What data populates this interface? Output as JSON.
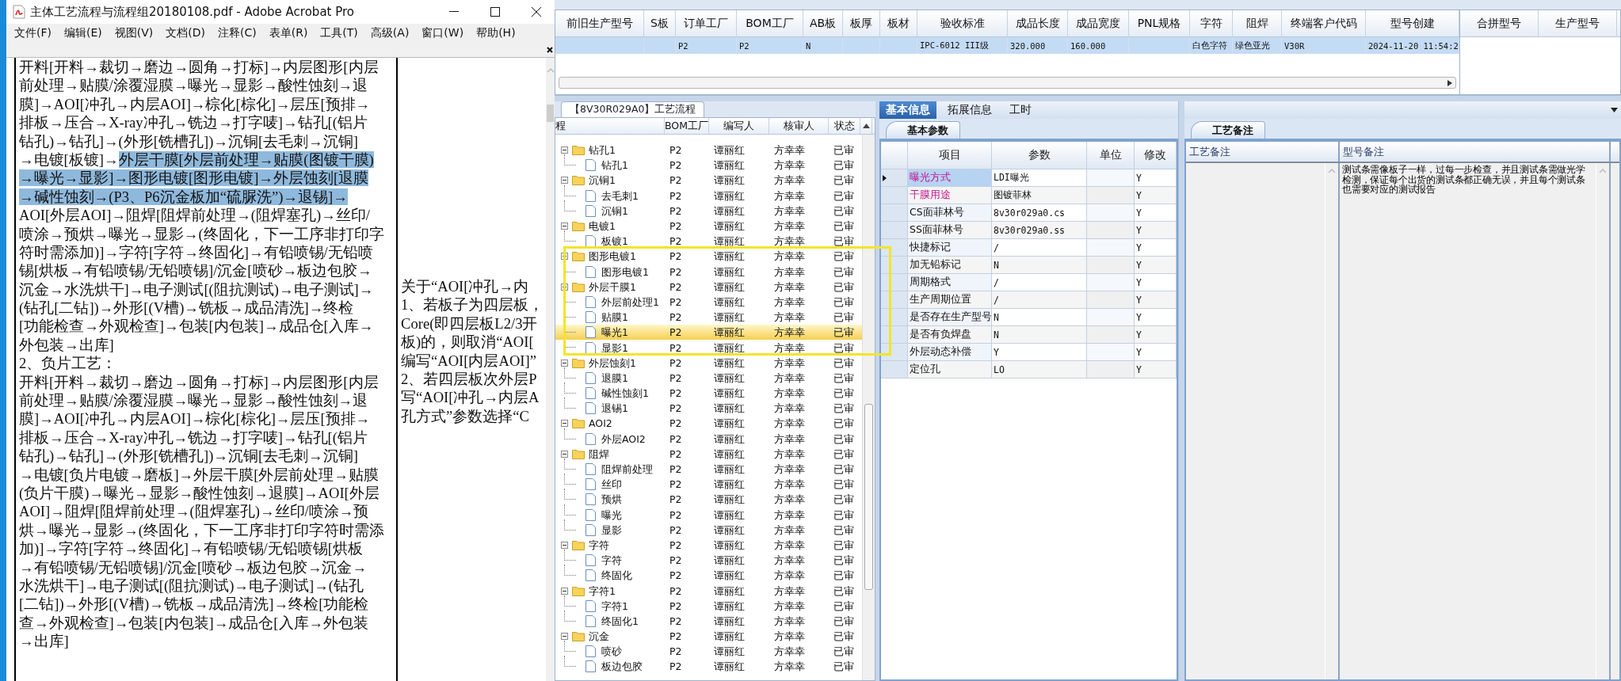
{
  "acrobat": {
    "title": "主体工艺流程与流程组20180108.pdf - Adobe Acrobat Pro",
    "menu": [
      "文件(F)",
      "编辑(E)",
      "视图(V)",
      "文档(D)",
      "注释(C)",
      "表单(R)",
      "工具(T)",
      "高级(A)",
      "窗口(W)",
      "帮助(H)"
    ],
    "main_lines": [
      [
        {
          "text": "开料[开料→裁切→磨边→圆角→打标]→内层图形[内层",
          "highlighted": false
        }
      ],
      [
        {
          "text": "前处理→贴膜/涂覆湿膜→曝光→显影→酸性蚀刻→退",
          "highlighted": false
        }
      ],
      [
        {
          "text": "膜]→AOI[冲孔→内层AOI]→棕化[棕化]→层压[预排→",
          "highlighted": false
        }
      ],
      [
        {
          "text": "排板→压合→X-ray冲孔→铣边→打字唛]→钻孔[(铝片",
          "highlighted": false
        }
      ],
      [
        {
          "text": "钻孔)→钻孔]→(外形[铣槽孔])→沉铜[去毛刺→沉铜]",
          "highlighted": false
        }
      ],
      [
        {
          "text": "→电镀[板镀]→",
          "highlighted": false
        },
        {
          "text": "外层干膜[外层前处理→贴膜(图镀干膜)",
          "highlighted": true
        }
      ],
      [
        {
          "text": "→曝光→显影]→图形电镀[图形电镀]→外层蚀刻[退膜",
          "highlighted": true
        }
      ],
      [
        {
          "text": "→碱性蚀刻→(P3、P6沉金板加“硫脲洗”)→退锡]→",
          "highlighted": true
        }
      ],
      [
        {
          "text": "AOI[外层AOI]→阻焊[阻焊前处理→(阻焊塞孔)→丝印/",
          "highlighted": false
        }
      ],
      [
        {
          "text": "喷涂→预烘→曝光→显影→(终固化，下一工序非打印字",
          "highlighted": false
        }
      ],
      [
        {
          "text": "符时需添加)]→字符[字符→终固化]→有铅喷锡/无铅喷",
          "highlighted": false
        }
      ],
      [
        {
          "text": "锡[烘板→有铅喷锡/无铅喷锡]/沉金[喷砂→板边包胶→",
          "highlighted": false
        }
      ],
      [
        {
          "text": "沉金→水洗烘干]→电子测试[(阻抗测试)→电子测试]→",
          "highlighted": false
        }
      ],
      [
        {
          "text": "(钻孔[二钻])→外形[(V槽)→铣板→成品清洗]→终检",
          "highlighted": false
        }
      ],
      [
        {
          "text": "[功能检查→外观检查]→包装[内包装]→成品仓[入库→",
          "highlighted": false
        }
      ],
      [
        {
          "text": "外包装→出库]",
          "highlighted": false
        }
      ],
      [
        {
          "text": "2、负片工艺：",
          "highlighted": false
        }
      ],
      [
        {
          "text": "开料[开料→裁切→磨边→圆角→打标]→内层图形[内层",
          "highlighted": false
        }
      ],
      [
        {
          "text": "前处理→贴膜/涂覆湿膜→曝光→显影→酸性蚀刻→退",
          "highlighted": false
        }
      ],
      [
        {
          "text": "膜]→AOI[冲孔→内层AOI]→棕化[棕化]→层压[预排→",
          "highlighted": false
        }
      ],
      [
        {
          "text": "排板→压合→X-ray冲孔→铣边→打字唛]→钻孔[(铝片",
          "highlighted": false
        }
      ],
      [
        {
          "text": "钻孔)→钻孔]→(外形[铣槽孔])→沉铜[去毛刺→沉铜]",
          "highlighted": false
        }
      ],
      [
        {
          "text": "→电镀[负片电镀→磨板]→外层干膜[外层前处理→贴膜",
          "highlighted": false
        }
      ],
      [
        {
          "text": "(负片干膜)→曝光→显影→酸性蚀刻→退膜]→AOI[外层",
          "highlighted": false
        }
      ],
      [
        {
          "text": "AOI]→阻焊[阻焊前处理→(阻焊塞孔)→丝印/喷涂→预",
          "highlighted": false
        }
      ],
      [
        {
          "text": "烘→曝光→显影→(终固化，下一工序非打印字符时需添",
          "highlighted": false
        }
      ],
      [
        {
          "text": "加)]→字符[字符→终固化]→有铅喷锡/无铅喷锡[烘板",
          "highlighted": false
        }
      ],
      [
        {
          "text": "→有铅喷锡/无铅喷锡]/沉金[喷砂→板边包胶→沉金→",
          "highlighted": false
        }
      ],
      [
        {
          "text": "水洗烘干]→电子测试[(阻抗测试)→电子测试]→(钻孔",
          "highlighted": false
        }
      ],
      [
        {
          "text": "[二钻])→外形[(V槽)→铣板→成品清洗]→终检[功能检",
          "highlighted": false
        }
      ],
      [
        {
          "text": "查→外观检查]→包装[内包装]→成品仓[入库→外包装",
          "highlighted": false
        }
      ],
      [
        {
          "text": "→出库]",
          "highlighted": false
        }
      ]
    ],
    "side_lines": [
      "关于“AOI[冲孔→内",
      "1、若板子为四层板，",
      "Core(即四层板L2/3开",
      "板)的，则取消“AOI[",
      "编写“AOI[内层AOI]”",
      "2、若四层板次外层P",
      "写“AOI[冲孔→内层A",
      "孔方式”参数选择“C"
    ]
  },
  "top_grid": {
    "columns": [
      "前旧生产型号",
      "S板",
      "订单工厂",
      "BOM工厂",
      "AB板",
      "板厚",
      "板材",
      "验收标准",
      "成品长度",
      "成品宽度",
      "PNL规格",
      "字符",
      "阻焊",
      "终端客户代码",
      "型号创建"
    ],
    "rows": [
      {
        "selected": true,
        "cells": [
          null,
          null,
          "P2",
          "P2",
          "N",
          null,
          null,
          "IPC-6012 III级",
          "320.000",
          "160.000",
          null,
          "白色字符",
          "绿色亚光",
          "V30R",
          "2024-11-20 11:54:2"
        ]
      }
    ]
  },
  "side_grid": {
    "columns": [
      "合拼型号",
      "生产型号"
    ]
  },
  "process_panel": {
    "tab": "【8V30R029A0】工艺流程",
    "columns": [
      "程",
      "BOM工厂",
      "编写人",
      "核审人",
      "状态"
    ],
    "tree": [
      {
        "name": "钻孔1",
        "bom": "P2",
        "writer": "谭丽红",
        "reviewer": "方幸幸",
        "status": "已审",
        "expanded": true,
        "selected": false,
        "children": [
          {
            "name": "钻孔1",
            "bom": "P2",
            "writer": "谭丽红",
            "reviewer": "方幸幸",
            "status": "已审",
            "selected": false
          }
        ]
      },
      {
        "name": "沉铜1",
        "bom": "P2",
        "writer": "谭丽红",
        "reviewer": "方幸幸",
        "status": "已审",
        "expanded": true,
        "selected": false,
        "children": [
          {
            "name": "去毛刺1",
            "bom": "P2",
            "writer": "谭丽红",
            "reviewer": "方幸幸",
            "status": "已审",
            "selected": false
          },
          {
            "name": "沉铜1",
            "bom": "P2",
            "writer": "谭丽红",
            "reviewer": "方幸幸",
            "status": "已审",
            "selected": false
          }
        ]
      },
      {
        "name": "电镀1",
        "bom": "P2",
        "writer": "谭丽红",
        "reviewer": "方幸幸",
        "status": "已审",
        "expanded": true,
        "selected": false,
        "children": [
          {
            "name": "板镀1",
            "bom": "P2",
            "writer": "谭丽红",
            "reviewer": "方幸幸",
            "status": "已审",
            "selected": false
          }
        ]
      },
      {
        "name": "图形电镀1",
        "bom": "P2",
        "writer": "谭丽红",
        "reviewer": "方幸幸",
        "status": "已审",
        "expanded": true,
        "selected": false,
        "children": [
          {
            "name": "图形电镀1",
            "bom": "P2",
            "writer": "谭丽红",
            "reviewer": "方幸幸",
            "status": "已审",
            "selected": false
          }
        ]
      },
      {
        "name": "外层干膜1",
        "bom": "P2",
        "writer": "谭丽红",
        "reviewer": "方幸幸",
        "status": "已审",
        "expanded": true,
        "selected": false,
        "children": [
          {
            "name": "外层前处理1",
            "bom": "P2",
            "writer": "谭丽红",
            "reviewer": "方幸幸",
            "status": "已审",
            "selected": false
          },
          {
            "name": "贴膜1",
            "bom": "P2",
            "writer": "谭丽红",
            "reviewer": "方幸幸",
            "status": "已审",
            "selected": false
          },
          {
            "name": "曝光1",
            "bom": "P2",
            "writer": "谭丽红",
            "reviewer": "方幸幸",
            "status": "已审",
            "selected": true
          },
          {
            "name": "显影1",
            "bom": "P2",
            "writer": "谭丽红",
            "reviewer": "方幸幸",
            "status": "已审",
            "selected": false
          }
        ]
      },
      {
        "name": "外层蚀刻1",
        "bom": "P2",
        "writer": "谭丽红",
        "reviewer": "方幸幸",
        "status": "已审",
        "expanded": true,
        "selected": false,
        "children": [
          {
            "name": "退膜1",
            "bom": "P2",
            "writer": "谭丽红",
            "reviewer": "方幸幸",
            "status": "已审",
            "selected": false
          },
          {
            "name": "碱性蚀刻1",
            "bom": "P2",
            "writer": "谭丽红",
            "reviewer": "方幸幸",
            "status": "已审",
            "selected": false
          },
          {
            "name": "退锡1",
            "bom": "P2",
            "writer": "谭丽红",
            "reviewer": "方幸幸",
            "status": "已审",
            "selected": false
          }
        ]
      },
      {
        "name": "AOI2",
        "bom": "P2",
        "writer": "谭丽红",
        "reviewer": "方幸幸",
        "status": "已审",
        "expanded": true,
        "selected": false,
        "children": [
          {
            "name": "外层AOI2",
            "bom": "P2",
            "writer": "谭丽红",
            "reviewer": "方幸幸",
            "status": "已审",
            "selected": false
          }
        ]
      },
      {
        "name": "阻焊",
        "bom": "P2",
        "writer": "谭丽红",
        "reviewer": "方幸幸",
        "status": "已审",
        "expanded": true,
        "selected": false,
        "children": [
          {
            "name": "阻焊前处理",
            "bom": "P2",
            "writer": "谭丽红",
            "reviewer": "方幸幸",
            "status": "已审",
            "selected": false
          },
          {
            "name": "丝印",
            "bom": "P2",
            "writer": "谭丽红",
            "reviewer": "方幸幸",
            "status": "已审",
            "selected": false
          },
          {
            "name": "预烘",
            "bom": "P2",
            "writer": "谭丽红",
            "reviewer": "方幸幸",
            "status": "已审",
            "selected": false
          },
          {
            "name": "曝光",
            "bom": "P2",
            "writer": "谭丽红",
            "reviewer": "方幸幸",
            "status": "已审",
            "selected": false
          },
          {
            "name": "显影",
            "bom": "P2",
            "writer": "谭丽红",
            "reviewer": "方幸幸",
            "status": "已审",
            "selected": false
          }
        ]
      },
      {
        "name": "字符",
        "bom": "P2",
        "writer": "谭丽红",
        "reviewer": "方幸幸",
        "status": "已审",
        "expanded": true,
        "selected": false,
        "children": [
          {
            "name": "字符",
            "bom": "P2",
            "writer": "谭丽红",
            "reviewer": "方幸幸",
            "status": "已审",
            "selected": false
          },
          {
            "name": "终固化",
            "bom": "P2",
            "writer": "谭丽红",
            "reviewer": "方幸幸",
            "status": "已审",
            "selected": false
          }
        ]
      },
      {
        "name": "字符1",
        "bom": "P2",
        "writer": "谭丽红",
        "reviewer": "方幸幸",
        "status": "已审",
        "expanded": true,
        "selected": false,
        "children": [
          {
            "name": "字符1",
            "bom": "P2",
            "writer": "谭丽红",
            "reviewer": "方幸幸",
            "status": "已审",
            "selected": false
          },
          {
            "name": "终固化1",
            "bom": "P2",
            "writer": "谭丽红",
            "reviewer": "方幸幸",
            "status": "已审",
            "selected": false
          }
        ]
      },
      {
        "name": "沉金",
        "bom": "P2",
        "writer": "谭丽红",
        "reviewer": "方幸幸",
        "status": "已审",
        "expanded": true,
        "selected": false,
        "children": [
          {
            "name": "喷砂",
            "bom": "P2",
            "writer": "谭丽红",
            "reviewer": "方幸幸",
            "status": "已审",
            "selected": false
          },
          {
            "name": "板边包胶",
            "bom": "P2",
            "writer": "谭丽红",
            "reviewer": "方幸幸",
            "status": "已审",
            "selected": false
          }
        ]
      }
    ]
  },
  "info_panel": {
    "tabs": [
      {
        "label": "基本信息",
        "selected": true
      },
      {
        "label": "拓展信息",
        "selected": false
      },
      {
        "label": "工时",
        "selected": false
      }
    ],
    "subtab": "基本参数",
    "columns": [
      "项目",
      "参数",
      "单位",
      "修改"
    ],
    "rows": [
      {
        "item": "曝光方式",
        "value": "LDI曝光",
        "modify": "Y",
        "color": "#c0168c",
        "selected": true
      },
      {
        "item": "干膜用途",
        "value": "图镀菲林",
        "modify": "Y",
        "color": "#c0168c",
        "selected": false
      },
      {
        "item": "CS面菲林号",
        "value": "8v30r029a0.cs",
        "modify": "Y",
        "selected": false
      },
      {
        "item": "SS面菲林号",
        "value": "8v30r029a0.ss",
        "modify": "Y",
        "selected": false
      },
      {
        "item": "快捷标记",
        "value": "/",
        "modify": "Y",
        "selected": false
      },
      {
        "item": "加无铅标记",
        "value": "N",
        "modify": "Y",
        "selected": false
      },
      {
        "item": "周期格式",
        "value": "/",
        "modify": "Y",
        "selected": false
      },
      {
        "item": "生产周期位置",
        "value": "/",
        "modify": "Y",
        "selected": false
      },
      {
        "item": "是否存在生产型号",
        "value": "N",
        "modify": "Y",
        "selected": false
      },
      {
        "item": "是否有负焊盘",
        "value": "N",
        "modify": "Y",
        "selected": false
      },
      {
        "item": "外层动态补偿",
        "value": "Y",
        "modify": "Y",
        "selected": false
      },
      {
        "item": "定位孔",
        "value": "LO",
        "modify": "Y",
        "selected": false
      }
    ]
  },
  "remarks_panel": {
    "subtab": "工艺备注",
    "columns": [
      "工艺备注",
      "型号备注"
    ],
    "model_remark": "测试条需像板子一样，过每一步检查，并且测试条需做光学检测，保证每个出货的测试条都正确无误，并且每个测试条也需要对应的测试报告"
  }
}
